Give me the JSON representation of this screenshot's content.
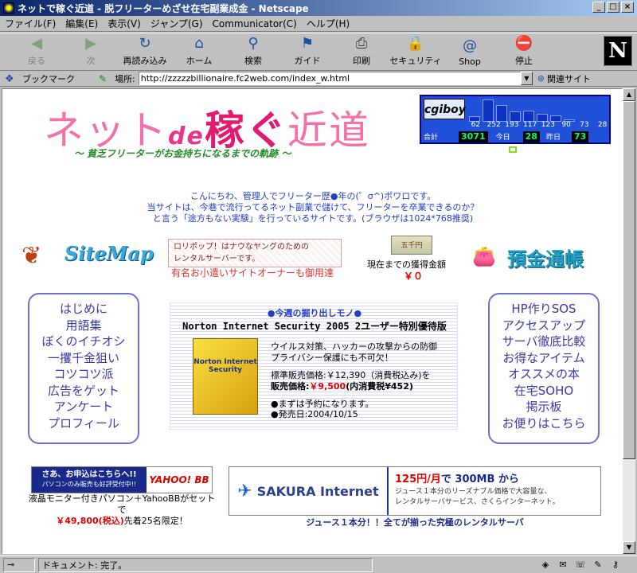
{
  "window": {
    "title": "ネットで稼ぐ近道 - 脱フリーターめざせ在宅副業成金 - Netscape",
    "buttons": [
      "_",
      "□",
      "×"
    ]
  },
  "menubar": {
    "items": [
      "ファイル(F)",
      "編集(E)",
      "表示(V)",
      "ジャンプ(G)",
      "Communicator(C)",
      "ヘルプ(H)"
    ]
  },
  "toolbar": {
    "items": [
      {
        "label": "戻る",
        "icon": "back-arrow-icon",
        "glyph": "◀",
        "disabled": true
      },
      {
        "label": "次",
        "icon": "forward-arrow-icon",
        "glyph": "▶",
        "disabled": true
      },
      {
        "label": "再読み込み",
        "icon": "reload-icon",
        "glyph": "↻",
        "disabled": false
      },
      {
        "label": "ホーム",
        "icon": "home-icon",
        "glyph": "⌂",
        "disabled": false
      },
      {
        "label": "検索",
        "icon": "search-icon",
        "glyph": "⚲",
        "disabled": false
      },
      {
        "label": "ガイド",
        "icon": "guide-icon",
        "glyph": "⚑",
        "disabled": false
      },
      {
        "label": "印刷",
        "icon": "print-icon",
        "glyph": "⎙",
        "disabled": false
      },
      {
        "label": "セキュリティ",
        "icon": "security-lock-icon",
        "glyph": "🔒",
        "disabled": false
      },
      {
        "label": "Shop",
        "icon": "shop-icon",
        "glyph": "@",
        "disabled": false
      },
      {
        "label": "停止",
        "icon": "stop-icon",
        "glyph": "⛔",
        "disabled": false
      }
    ],
    "logo": "N"
  },
  "location": {
    "bookmark_label": "ブックマーク",
    "location_label": "場所:",
    "url": "http://zzzzzbillionaire.fc2web.com/index_w.html",
    "related_label": "関連サイト"
  },
  "content": {
    "logo": {
      "part1": "ネット",
      "part2": "de",
      "part3": "稼ぐ",
      "part4": "近道"
    },
    "subtitle": "～ 貧乏フリーターがお金持ちになるまでの軌跡 ～",
    "counter": {
      "brand": "cgiboy",
      "bars": [
        62,
        252,
        193,
        117,
        123,
        90,
        73,
        28
      ],
      "bar_labels": [
        "62",
        "252",
        "193",
        "117",
        "123",
        "90",
        "73",
        "28"
      ],
      "total_label": "合計",
      "total": "3071",
      "today_label": "今日",
      "today": "28",
      "yesterday_label": "昨日",
      "yesterday": "73"
    },
    "intro": [
      "こんにちわ、管理人でフリーター歴●年の(゜σ^)ポワロです。",
      "当サイトは、今巷で流行ってるネット副業で儲けて、フリーターを卒業できるのか？",
      "と言う「途方もない実験」を行っているサイトです。(ブラウザは1024*768推奨)"
    ],
    "sitemap": "SiteMap",
    "lolipop": {
      "line1": "ロリポップ！はナウなヤングのための",
      "line2": "レンタルサーバーです。",
      "caption": "有名お小遣いサイトオーナーも御用達"
    },
    "money": {
      "image_text": "五千円",
      "label": "現在までの獲得金額",
      "value": "￥０"
    },
    "bankbook": "預金通帳",
    "left_menu": [
      "はじめに",
      "用語集",
      "ぼくのイチオシ",
      "一攫千金狙い",
      "コツコツ派",
      "広告をゲット",
      "アンケート",
      "プロフィール"
    ],
    "right_menu": [
      "HP作りSOS",
      "アクセスアップ",
      "サーバ徹底比較",
      "お得なアイテム",
      "オススメの本",
      "在宅SOHO",
      "掲示板",
      "お便りはこちら"
    ],
    "feature": {
      "heading": "●今週の掘り出しモノ●",
      "title": "Norton Internet Security 2005 2ユーザー特別優待版",
      "box_text": "Norton Internet Security",
      "desc1": "ウイルス対策、ハッカーの攻撃からの防御",
      "desc2": "プライバシー保護にも不可欠！",
      "std_price": "標準販売価格:￥12,390（消費税込み)を",
      "sale_label": "販売価格:",
      "sale_price": "￥9,500",
      "sale_tax": "(内消費税¥452)",
      "note1": "●まずは予約になります。",
      "note2": "●発売日:2004/10/15"
    },
    "yahoo": {
      "banner_main": "さあ、お申込はこちらへ!!",
      "banner_sub": "パソコンのみ販売も好評受付中!!",
      "banner_logo": "YAHOO! BB",
      "text1": "液晶モニター付きパソコン＋YahooBBがセットで",
      "price": "￥49,800(税込)",
      "text2": "先着25名限定！"
    },
    "sakura": {
      "logo": "SAKURA Internet",
      "price": "125円/月",
      "price_rest": "で 300MB から",
      "desc1": "ジュース１本分のリーズナブル価格で大容量な、",
      "desc2": "レンタルサーバサービス、さくらインターネット。",
      "caption": "ジュース１本分！！全てが揃った究極のレンタルサーバ"
    }
  },
  "status": {
    "text": "ドキュメント: 完了。"
  }
}
